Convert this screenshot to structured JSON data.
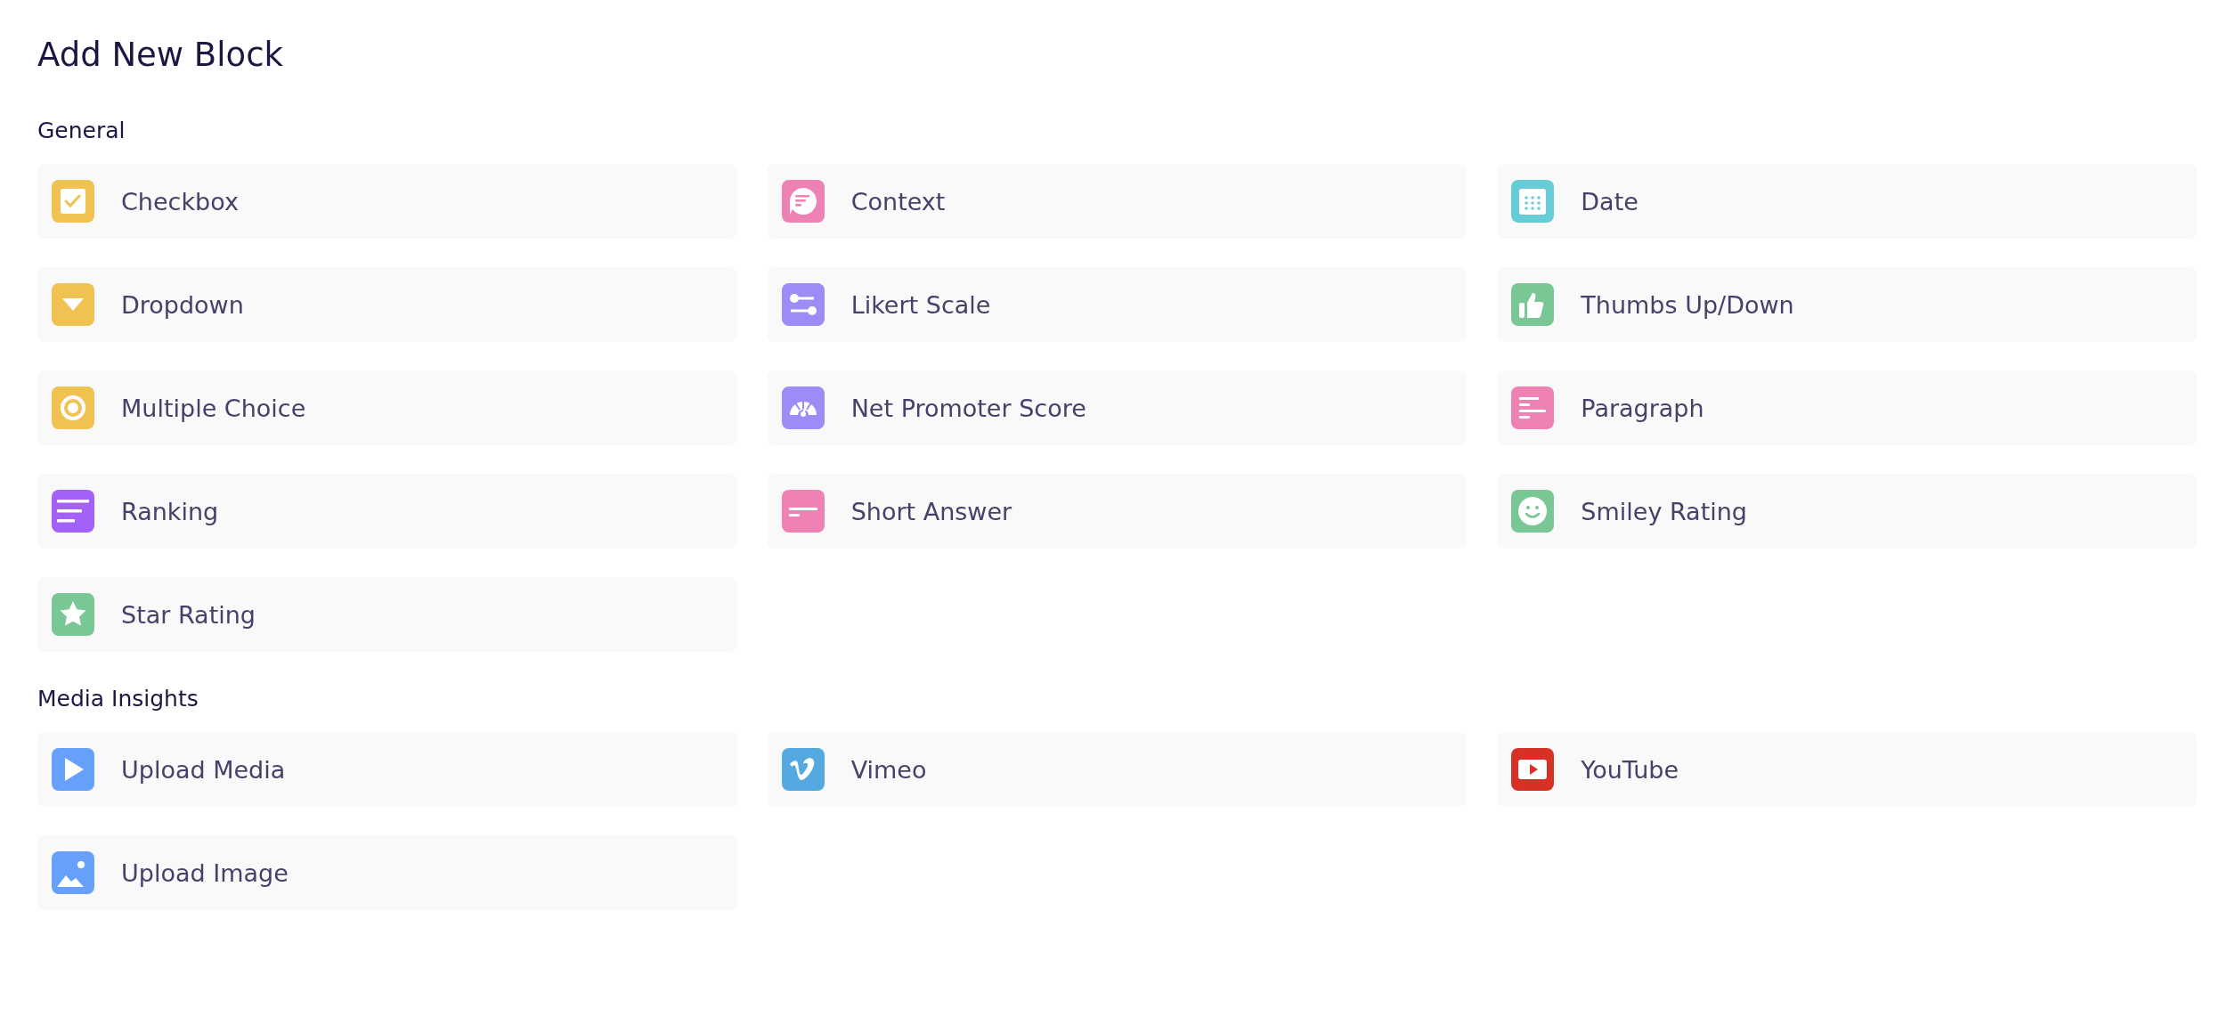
{
  "title": "Add New Block",
  "sections": [
    {
      "heading": "General",
      "blocks": [
        {
          "label": "Checkbox",
          "kind": "checkbox",
          "color": "#f0c251"
        },
        {
          "label": "Context",
          "kind": "context",
          "color": "#ee82b5"
        },
        {
          "label": "Date",
          "kind": "date",
          "color": "#66ccd8"
        },
        {
          "label": "Dropdown",
          "kind": "dropdown",
          "color": "#f0c251"
        },
        {
          "label": "Likert Scale",
          "kind": "likert",
          "color": "#9b8cf6"
        },
        {
          "label": "Thumbs Up/Down",
          "kind": "thumbs",
          "color": "#79c795"
        },
        {
          "label": "Multiple Choice",
          "kind": "choice",
          "color": "#f0c251"
        },
        {
          "label": "Net Promoter Score",
          "kind": "nps",
          "color": "#9b8cf6"
        },
        {
          "label": "Paragraph",
          "kind": "paragraph",
          "color": "#ee82b5"
        },
        {
          "label": "Ranking",
          "kind": "ranking",
          "color": "#a461f7"
        },
        {
          "label": "Short Answer",
          "kind": "short",
          "color": "#ee82b5"
        },
        {
          "label": "Smiley Rating",
          "kind": "smiley",
          "color": "#79c795"
        },
        {
          "label": "Star Rating",
          "kind": "star",
          "color": "#79c795"
        }
      ]
    },
    {
      "heading": "Media Insights",
      "blocks": [
        {
          "label": "Upload Media",
          "kind": "media",
          "color": "#66a0fb"
        },
        {
          "label": "Vimeo",
          "kind": "vimeo",
          "color": "#55a8e0"
        },
        {
          "label": "YouTube",
          "kind": "youtube",
          "color": "#d93025"
        },
        {
          "label": "Upload Image",
          "kind": "image",
          "color": "#66a0fb"
        }
      ]
    }
  ]
}
